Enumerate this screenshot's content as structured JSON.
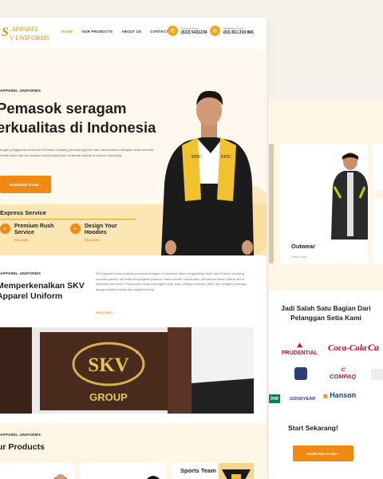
{
  "colors": {
    "accent": "#f08a12",
    "gold": "#c9961a",
    "cream": "#fff8ee",
    "band": "#fbe6b4"
  },
  "nav": {
    "logo_top": "APPAREL",
    "logo_bottom": "V UNIFORMS",
    "links": [
      "HOME",
      "OUR PRODUCTS",
      "ABOUT US",
      "CONTACT US"
    ],
    "phone_label": "Hubungi Kami",
    "phone": "(022) 5431234",
    "whatsapp_label": "WhatsApp Kami",
    "whatsapp": "(63) 811 219 865"
  },
  "hero": {
    "eyebrow": "APPAREL UNIFORMS",
    "title_line1": "Pemasok seragam",
    "title_line2": "erkualitas di Indonesia",
    "desc": "engan pengalaman lebih dari 20 tahun di bidang produksi garmen dan mencerahkan seragam untuk sekolah, rumah sakit, dan perusahaan serta institusi lain di daerah-daerah di seluruh Indonesia.",
    "cta": "HUBUNGI KAMI  ›",
    "sash_text": "EPIC",
    "express_title": "Express Service",
    "services": [
      {
        "title": "Premium Rush Service",
        "link": "PELAJARI  ›"
      },
      {
        "title": "Design Your Hoodies",
        "link": "PELAJARI  ›"
      }
    ]
  },
  "about": {
    "eyebrow": "APPAREL UNIFORMS",
    "title": "Memperkenalkan SKV Apparel Uniform",
    "desc": "SKV Apparel Uniform adalah pemasok seragam di Indonesia, kami menghadirkan lebih dari 20 tahun di bidang produksi garmen dan telah mengerjakan pesanan untuk sekolah, rumah sakit, perusahaan serta institusi lain di Indonesia dan dunia. Produk kami meliputi seragam kerja, kaos, seragam sekolah, jaket, dan seragam olahraga dengan kualitas terbaik dan harga bersaing.",
    "more": "PELAJARI  ›",
    "sign_main": "SKV",
    "sign_reg": "®",
    "sign_group": "GROUP"
  },
  "products": {
    "eyebrow": "APPAREL UNIFORMS",
    "title": "ur Products",
    "sports_label": "Sports Team"
  },
  "right": {
    "card_title": "Outwear",
    "card_link": "Lihat Produk",
    "clients_title": "Jadi Salah Satu Bagian Dari Pelanggan Setia Kami",
    "clients": [
      "PRUDENTIAL",
      "Coca-Cola",
      "Ca",
      "COMPAQ",
      "ine",
      "GOODYEAR",
      "Hanson"
    ],
    "start_title": "Start Sekarang!",
    "cta": "HUBUNGI KAMI  ›"
  }
}
